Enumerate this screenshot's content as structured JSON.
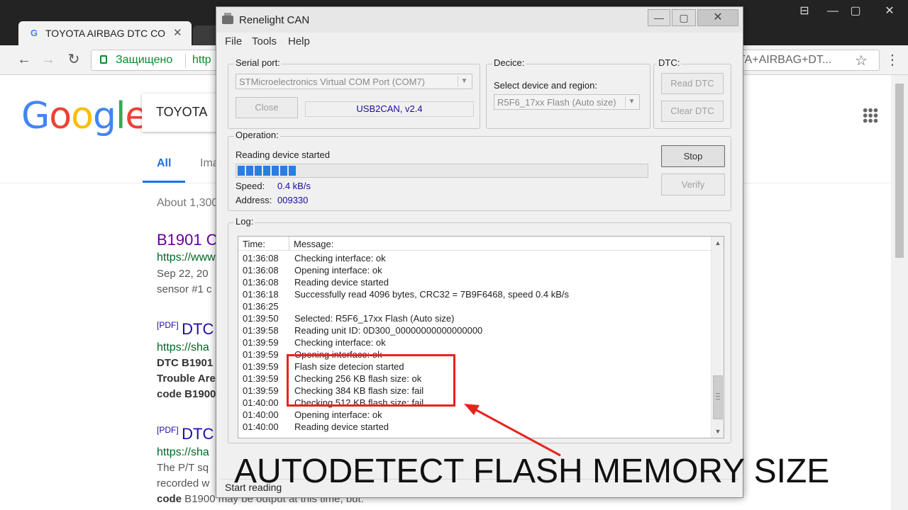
{
  "browser": {
    "tab_title": "TOYOTA AIRBAG DTC CO",
    "tab_favicon": "G",
    "secure_label": "Защищено",
    "url_start": "http",
    "url_end": "TA+AIRBAG+DT...",
    "search_query": "TOYOTA"
  },
  "google": {
    "logo": [
      "G",
      "o",
      "o",
      "g",
      "l",
      "e"
    ],
    "tabs": {
      "all": "All",
      "images": "Ima"
    },
    "result_stats": "About 1,300",
    "results": [
      {
        "title": "B1901 C",
        "url": "https://www",
        "snippet1": "Sep 22, 20",
        "snippet2": "sensor #1 c"
      },
      {
        "pdf": "[PDF]",
        "title": "DTC",
        "url": "https://sha",
        "bold1": "DTC B1901",
        "bold2": "Trouble Are",
        "bold3": "code B1900"
      },
      {
        "pdf": "[PDF]",
        "title": "DTC",
        "url": "https://sha",
        "snippet1": "The P/T sq",
        "snippet2": "recorded w",
        "snippet3_bold": "code",
        "snippet3": " B1900 may be output at this time, but:"
      }
    ]
  },
  "app": {
    "title": "Renelight CAN",
    "menu": [
      "File",
      "Tools",
      "Help"
    ],
    "serial": {
      "group_label": "Serial port:",
      "port_value": "STMicroelectronics Virtual COM Port (COM7)",
      "close_label": "Close",
      "status_value": "USB2CAN, v2.4"
    },
    "device": {
      "group_label": "Decice:",
      "select_label": "Select device and region:",
      "device_value": "R5F6_17xx Flash (Auto size)"
    },
    "dtc": {
      "group_label": "DTC:",
      "read_label": "Read DTC",
      "clear_label": "Clear DTC"
    },
    "operation": {
      "group_label": "Operation:",
      "status_text": "Reading device started",
      "progress_segments": 7,
      "speed_label": "Speed:",
      "speed_value": "0.4 kB/s",
      "address_label": "Address:",
      "address_value": "009330",
      "stop_label": "Stop",
      "verify_label": "Verify"
    },
    "log": {
      "group_label": "Log:",
      "columns": {
        "time": "Time:",
        "message": "Message:"
      },
      "rows": [
        {
          "time": "01:36:08",
          "message": "Checking interface: ok"
        },
        {
          "time": "01:36:08",
          "message": "Opening interface: ok"
        },
        {
          "time": "01:36:08",
          "message": "Reading device started"
        },
        {
          "time": "01:36:18",
          "message": "Successfully read 4096 bytes, CRC32 = 7B9F6468, speed 0.4 kB/s"
        },
        {
          "time": "01:36:25",
          "message": ""
        },
        {
          "time": "01:39:50",
          "message": "Selected: R5F6_17xx Flash (Auto size)"
        },
        {
          "time": "01:39:58",
          "message": "Reading unit ID: 0D300_00000000000000000"
        },
        {
          "time": "01:39:59",
          "message": "Checking interface: ok"
        },
        {
          "time": "01:39:59",
          "message": "Opening interface: ok"
        },
        {
          "time": "01:39:59",
          "message": "Flash size detecion started"
        },
        {
          "time": "01:39:59",
          "message": "Checking 256 KB flash size: ok"
        },
        {
          "time": "01:39:59",
          "message": "Checking 384 KB flash size: fail"
        },
        {
          "time": "01:40:00",
          "message": "Checking 512 KB flash size: fail"
        },
        {
          "time": "01:40:00",
          "message": "Opening interface: ok"
        },
        {
          "time": "01:40:00",
          "message": "Reading device started"
        }
      ]
    },
    "status_bar": "Start reading"
  },
  "overlay": {
    "caption": "AUTODETECT FLASH MEMORY SIZE",
    "highlight_color": "#e8221e"
  },
  "icons": {
    "back": "arrow-left-icon",
    "forward": "arrow-right-icon",
    "reload": "reload-icon",
    "lock": "lock-icon",
    "star": "star-icon",
    "menu": "vertical-dots-icon",
    "apps": "apps-grid-icon"
  }
}
